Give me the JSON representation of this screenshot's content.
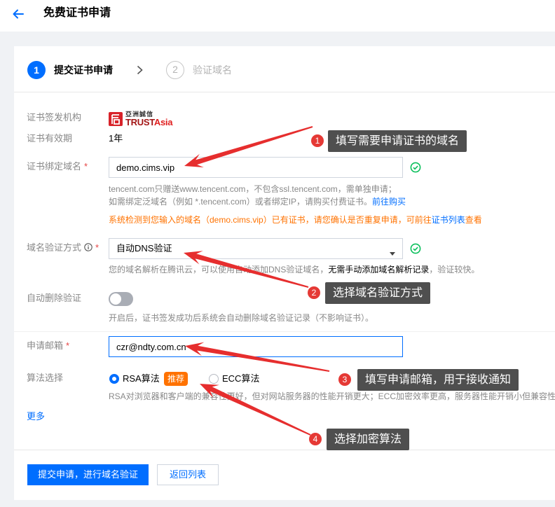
{
  "header": {
    "title": "免费证书申请",
    "back_icon": "arrow-left-icon"
  },
  "steps": [
    {
      "number": "1",
      "label": "提交证书申请",
      "active": true
    },
    {
      "number": "2",
      "label": "验证域名",
      "active": false
    }
  ],
  "step_separator_icon": "chevron-right-icon",
  "form": {
    "issuer": {
      "label": "证书签发机构",
      "logo": {
        "cn": "亞洲誠信",
        "en_part1": "TRUST",
        "en_part2": "Asia",
        "icon": "trustasia-logo-icon"
      }
    },
    "validity": {
      "label": "证书有效期",
      "value": "1年"
    },
    "domain": {
      "label": "证书绑定域名",
      "required_mark": "*",
      "value": "demo.cims.vip",
      "status_icon": "check-circle-icon",
      "help_line1": "tencent.com只赠送www.tencent.com，不包含ssl.tencent.com，需单独申请；",
      "help_line2": "如需绑定泛域名（例如 *.tencent.com）或者绑定IP，请购买付费证书。",
      "help_link": "前往购买",
      "warning_prefix": "系统检测到您输入的域名（demo.cims.vip）已有证书，请您确认是否重复申请，可前往",
      "warning_link": "证书列表",
      "warning_suffix": "查看"
    },
    "verify_method": {
      "label": "域名验证方式",
      "info_icon": "info-icon",
      "required_mark": "*",
      "value": "自动DNS验证",
      "dropdown_icon": "caret-down-icon",
      "status_icon": "check-circle-icon",
      "help_prefix": "您的域名解析在腾讯云，可以使用自动添加DNS验证域名，",
      "help_emphasis": "无需手动添加域名解析记录",
      "help_suffix": "，验证较快。"
    },
    "auto_delete": {
      "label": "自动删除验证",
      "enabled": false,
      "help": "开启后，证书签发成功后系统会自动删除域名验证记录（不影响证书）。"
    },
    "email": {
      "label": "申请邮箱",
      "required_mark": "*",
      "value": "czr@ndty.com.cn"
    },
    "algorithm": {
      "label": "算法选择",
      "options": [
        {
          "label": "RSA算法",
          "selected": true,
          "badge": "推荐"
        },
        {
          "label": "ECC算法",
          "selected": false
        }
      ],
      "help": "RSA对浏览器和客户端的兼容性更好，但对网站服务器的性能开销更大；ECC加密效率更高，服务器性能开销小但兼容性"
    },
    "more_link": "更多"
  },
  "actions": {
    "submit_label": "提交申请，进行域名验证",
    "back_label": "返回列表"
  },
  "annotations": [
    {
      "number": "1",
      "text": "填写需要申请证书的域名"
    },
    {
      "number": "2",
      "text": "选择域名验证方式"
    },
    {
      "number": "3",
      "text": "填写申请邮箱，用于接收通知"
    },
    {
      "number": "4",
      "text": "选择加密算法"
    }
  ],
  "colors": {
    "accent": "#006eff",
    "warning": "#ff7200",
    "success": "#0abf5b",
    "required": "#e54545",
    "badge": "#ff7200",
    "annotation_arrow": "#e62e2e",
    "annotation_number": "#e53935",
    "annotation_label_bg": "#4f4f4f"
  }
}
